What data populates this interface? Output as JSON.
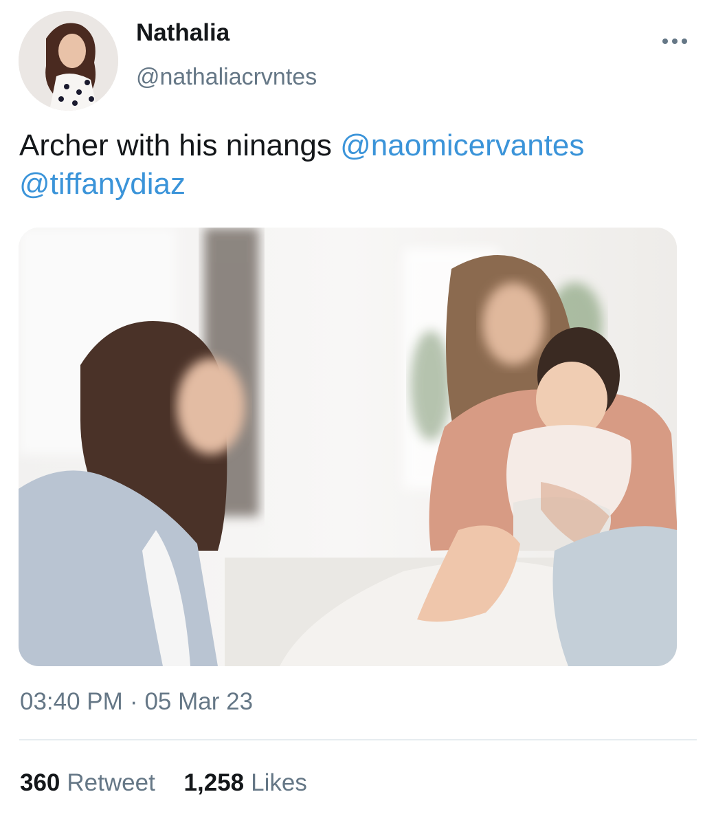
{
  "author": {
    "display_name": "Nathalia",
    "handle": "@nathaliacrvntes"
  },
  "tweet": {
    "text": "Archer with his ninangs",
    "mentions": [
      "@naomicervantes",
      "@tiffanydiaz"
    ]
  },
  "meta": {
    "time": "03:40 PM",
    "separator": "·",
    "date": "05 Mar 23"
  },
  "stats": {
    "retweets": "360",
    "retweet_label": "Retweet",
    "likes": "1,258",
    "likes_label": "Likes"
  },
  "icons": {
    "more": "more-horizontal-icon"
  },
  "colors": {
    "link": "#3b94d9",
    "secondary_text": "#657786",
    "primary_text": "#14171a",
    "divider": "#e6ecf0"
  }
}
